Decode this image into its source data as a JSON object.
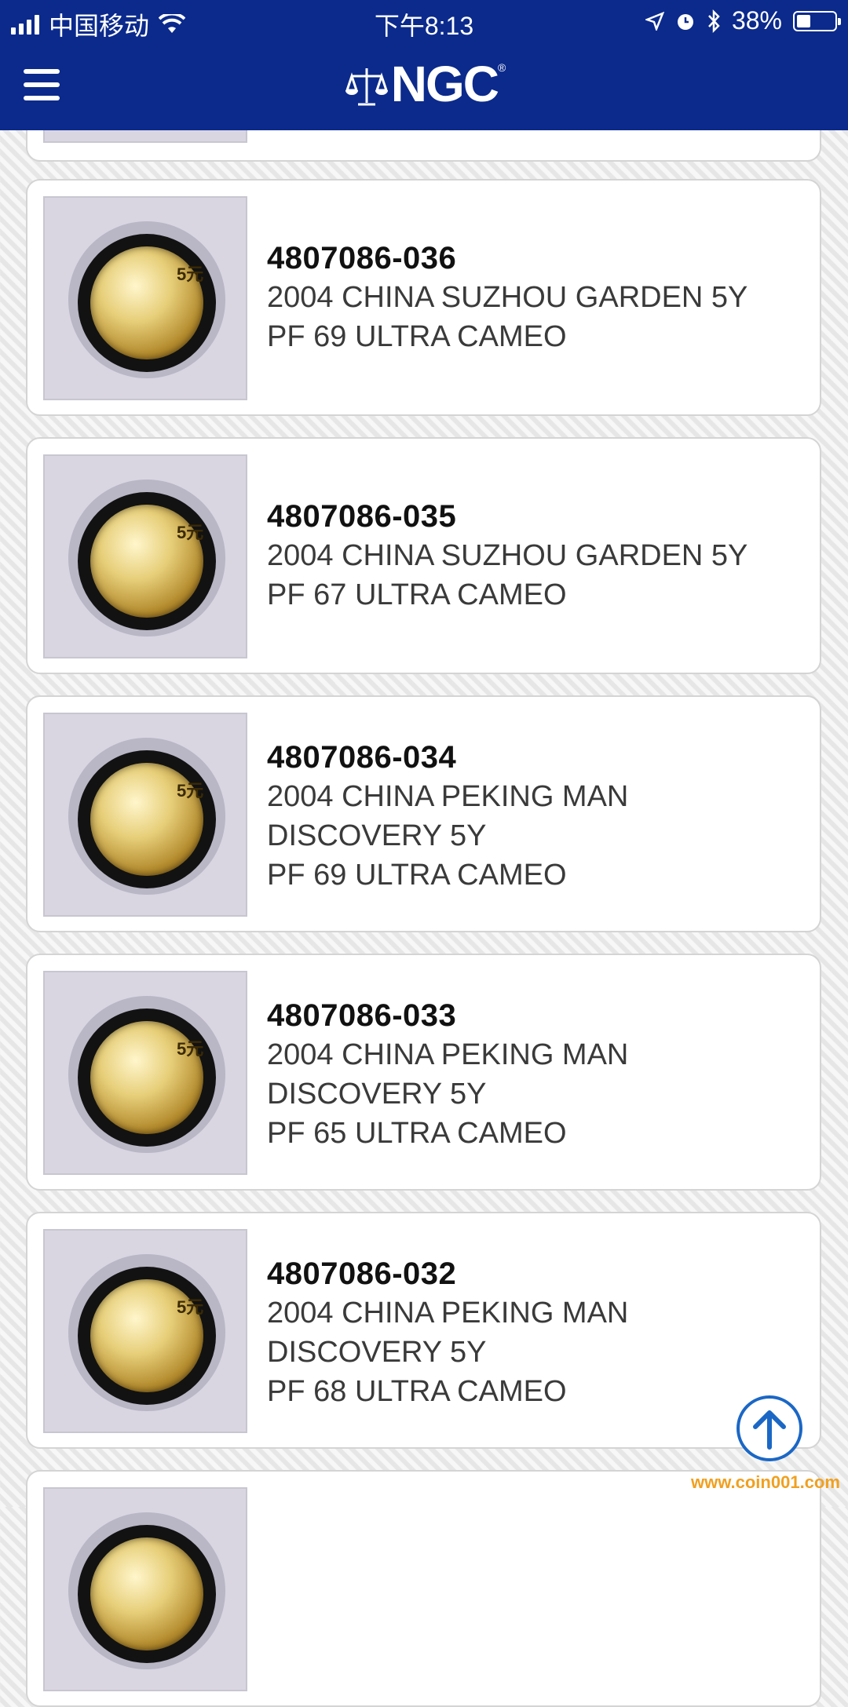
{
  "status_bar": {
    "carrier": "中国移动",
    "time": "下午8:13",
    "battery_percent": "38%",
    "battery_level": 0.38
  },
  "header": {
    "logo_text": "NGC",
    "logo_mark": "®",
    "menu_icon": "hamburger-menu-icon"
  },
  "coins": [
    {
      "cert": "4807086-036",
      "description": "2004 CHINA SUZHOU GARDEN 5Y",
      "grade": "PF 69 ULTRA CAMEO"
    },
    {
      "cert": "4807086-035",
      "description": "2004 CHINA SUZHOU GARDEN 5Y",
      "grade": "PF 67 ULTRA CAMEO"
    },
    {
      "cert": "4807086-034",
      "description": "2004 CHINA PEKING MAN\nDISCOVERY 5Y",
      "grade": "PF 69 ULTRA CAMEO"
    },
    {
      "cert": "4807086-033",
      "description": "2004 CHINA PEKING MAN\nDISCOVERY 5Y",
      "grade": "PF 65 ULTRA CAMEO"
    },
    {
      "cert": "4807086-032",
      "description": "2004 CHINA PEKING MAN\nDISCOVERY 5Y",
      "grade": "PF 68 ULTRA CAMEO"
    }
  ],
  "coin_denomination_mark": "5元",
  "scroll_top_icon": "arrow-up-circle-icon",
  "watermark": "www.coin001.com",
  "colors": {
    "header_bg": "#0b2a8c",
    "accent": "#1b67c5"
  }
}
